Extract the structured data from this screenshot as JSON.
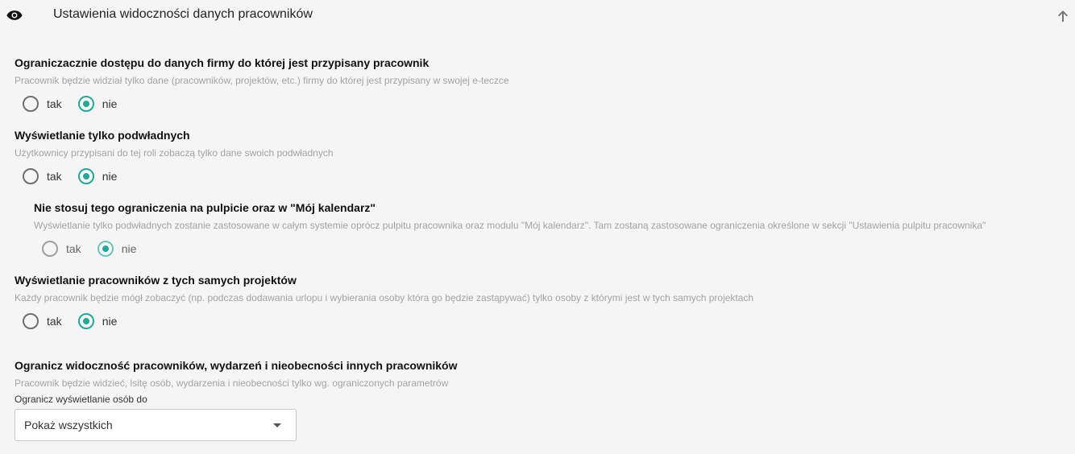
{
  "header": {
    "title": "Ustawienia widoczności danych pracowników",
    "visibility_icon": "eye-icon",
    "collapse_icon": "arrow-up-icon"
  },
  "colors": {
    "accent": "#26a69a",
    "muted_text": "#a3a3a3"
  },
  "sections": [
    {
      "title": "Ograniczacznie dostępu do danych firmy do której jest przypisany pracownik",
      "description": "Pracownik będzie widział tylko dane (pracowników, projektów, etc.) firmy do której jest przypisany w swojej e-teczce",
      "options": [
        "tak",
        "nie"
      ],
      "selected": "nie"
    },
    {
      "title": "Wyświetlanie tylko podwładnych",
      "description": "Użytkownicy przypisani do tej roli zobaczą tylko dane swoich podwładnych",
      "options": [
        "tak",
        "nie"
      ],
      "selected": "nie"
    },
    {
      "title": "Nie stosuj tego ograniczenia na pulpicie oraz w \"Mój kalendarz\"",
      "description": "Wyświetlanie tylko podwładnych zostanie zastosowane w całym systemie oprócz pulpitu pracownika oraz modulu \"Mój kalendarz\". Tam zostaną zastosowane ograniczenia określone w sekcji \"Ustawienia pulpitu pracownika\"",
      "options": [
        "tak",
        "nie"
      ],
      "selected": "nie"
    },
    {
      "title": "Wyświetlanie pracowników z tych samych projektów",
      "description": "Każdy pracownik będzie mógł zobaczyć (np. podczas dodawania urlopu i wybierania osoby która go będzie zastąpywać) tylko osoby z którymi jest w tych samych projektach",
      "options": [
        "tak",
        "nie"
      ],
      "selected": "nie"
    },
    {
      "title": "Ogranicz widoczność pracowników, wydarzeń i nieobecności innych pracowników",
      "description": "Pracownik będzie widzieć, lsitę osób, wydarzenia i nieobecności tylko wg. ograniczonych parametrów",
      "select_label": "Ogranicz wyświetlanie osób do",
      "select_value": "Pokaż wszystkich",
      "select_icon": "caret-down-icon"
    }
  ]
}
